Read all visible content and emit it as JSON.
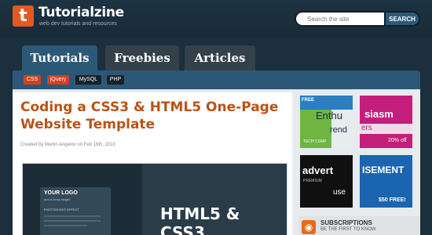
{
  "brand": {
    "logo_letter": "t",
    "name": "Tutorialzine",
    "tagline": "web dev tutorials and resources",
    "accent": "#e05a22"
  },
  "search": {
    "placeholder": "Search the site",
    "button": "SEARCH"
  },
  "tabs": [
    {
      "label": "Tutorials",
      "active": true
    },
    {
      "label": "Freebies",
      "active": false
    },
    {
      "label": "Articles",
      "active": false
    }
  ],
  "categories": [
    {
      "label": "CSS",
      "color": "#d2401e"
    },
    {
      "label": "jQuery",
      "color": "#d2401e"
    },
    {
      "label": "MySQL",
      "color": "#16222b"
    },
    {
      "label": "PHP",
      "color": "#16222b"
    }
  ],
  "article": {
    "title": "Coding a CSS3 & HTML5 One-Page Website Template",
    "meta": "Created by Martin Angelov on Feb 16th, 2010",
    "thumb_logo": "YOUR LOGO",
    "thumb_sub": "and a lousy slogan",
    "thumb_effect": "PHOTOSHOOT EFFECT",
    "thumb_headline": "HTML5 & CSS3"
  },
  "ads": [
    {
      "badge": "FREE",
      "text_top": "Enthu",
      "text_bottom": "rend",
      "footer": "TECH CORP"
    },
    {
      "text_top": "siasm",
      "text_mid": "ers",
      "text_bottom": "20% off"
    },
    {
      "text_top": "advert",
      "text_mid": "PREMIUM",
      "text_bottom": "use"
    },
    {
      "text_top": "ISEMENT",
      "text_bottom": "$50 FREE!"
    }
  ],
  "subscribe": {
    "title": "SUBSCRIPTIONS",
    "text": "BE THE FIRST TO KNOW"
  }
}
